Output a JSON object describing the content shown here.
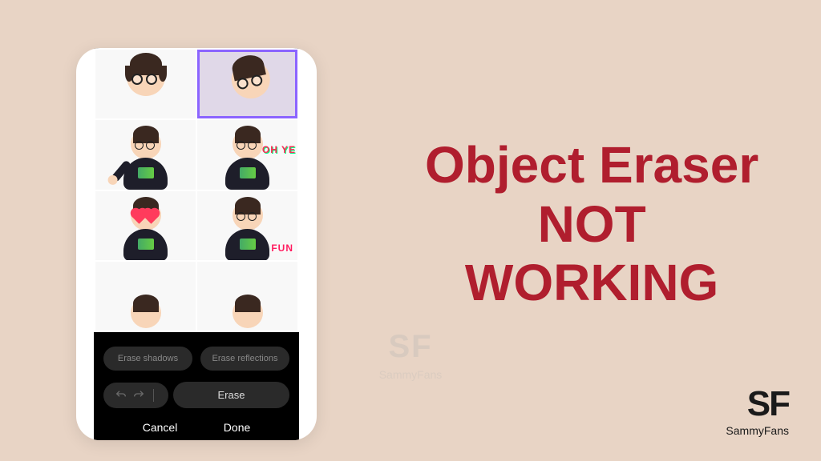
{
  "controls": {
    "erase_shadows": "Erase shadows",
    "erase_reflections": "Erase reflections",
    "erase": "Erase",
    "cancel": "Cancel",
    "done": "Done"
  },
  "title": {
    "line1": "Object Eraser",
    "line2": "NOT",
    "line3": "WORKING"
  },
  "watermark": {
    "big": "SF",
    "small": "SammyFans"
  },
  "brand": {
    "logo": "SF",
    "name": "SammyFans"
  },
  "overlays": {
    "oh_ye": "OH\nYE",
    "fun": "FUN"
  }
}
